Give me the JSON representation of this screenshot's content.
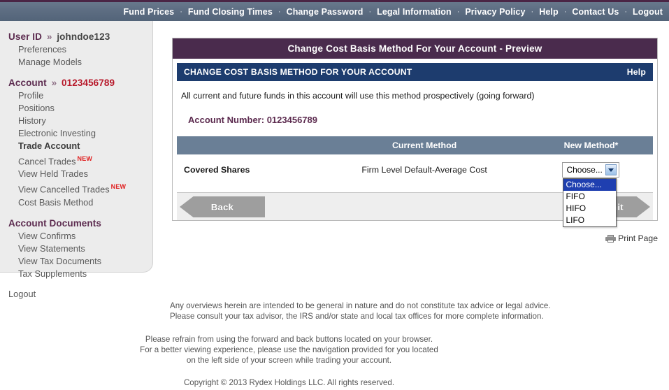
{
  "navbar": {
    "separator": "·",
    "links": [
      "Fund Prices",
      "Fund Closing Times",
      "Change Password",
      "Legal Information",
      "Privacy Policy",
      "Help",
      "Contact Us",
      "Logout"
    ]
  },
  "sidebar": {
    "user_section": {
      "label": "User ID",
      "chevron": "»",
      "value": "johndoe123",
      "items": [
        "Preferences",
        "Manage Models"
      ]
    },
    "account_section": {
      "label": "Account",
      "chevron": "»",
      "value": "0123456789",
      "items": [
        {
          "label": "Profile",
          "bold": false,
          "badge": ""
        },
        {
          "label": "Positions",
          "bold": false,
          "badge": ""
        },
        {
          "label": "History",
          "bold": false,
          "badge": ""
        },
        {
          "label": "Electronic Investing",
          "bold": false,
          "badge": ""
        },
        {
          "label": "Trade Account",
          "bold": true,
          "badge": ""
        },
        {
          "label": "Cancel Trades",
          "bold": false,
          "badge": "NEW"
        },
        {
          "label": "View Held Trades",
          "bold": false,
          "badge": ""
        },
        {
          "label": "View Cancelled Trades",
          "bold": false,
          "badge": "NEW"
        },
        {
          "label": "Cost Basis Method",
          "bold": false,
          "badge": ""
        }
      ]
    },
    "documents_section": {
      "label": "Account Documents",
      "items": [
        "View Confirms",
        "View Statements",
        "View Tax Documents",
        "Tax Supplements"
      ]
    },
    "logout": "Logout"
  },
  "card": {
    "title": "Change Cost Basis Method For Your Account - Preview",
    "banner_title": "CHANGE COST BASIS METHOD FOR YOUR ACCOUNT",
    "banner_help": "Help",
    "intro": "All current and future funds in this account will use this method prospectively (going forward)",
    "account_number_label": "Account Number:",
    "account_number_value": "0123456789",
    "table": {
      "headers": [
        "",
        "Current Method",
        "New Method*"
      ],
      "rows": [
        {
          "label": "Covered Shares",
          "current_method": "Firm Level Default-Average Cost",
          "new_method_selected": "Choose..."
        }
      ]
    },
    "dropdown": {
      "open": true,
      "options": [
        "Choose...",
        "FIFO",
        "HIFO",
        "LIFO"
      ],
      "selected_index": 0
    },
    "buttons": {
      "back": "Back",
      "submit": "Submit"
    },
    "print_page": "Print Page"
  },
  "footer": {
    "disclaimer_line1": "Any overviews herein are intended to be general in nature and do not constitute tax advice or legal advice.",
    "disclaimer_line2": "Please consult your tax advisor, the IRS and/or state and local tax offices for more complete information.",
    "notice_line1": "Please refrain from using the forward and back buttons located on your browser.",
    "notice_line2": "For a better viewing experience, please use the navigation provided for you located",
    "notice_line3": "on the left side of your screen while trading your account.",
    "copyright": "Copyright © 2013 Rydex Holdings LLC. All rights reserved."
  },
  "colors": {
    "navbar": "#5d6d82",
    "topline": "#4a2545",
    "card_title": "#4a2b4d",
    "banner": "#1d3c6e",
    "table_header": "#6a7f96",
    "accent_purple": "#5c2b4f",
    "new_badge": "#e02020",
    "dropdown_selected": "#1f3fb0",
    "button_gray": "#9e9e9e"
  }
}
